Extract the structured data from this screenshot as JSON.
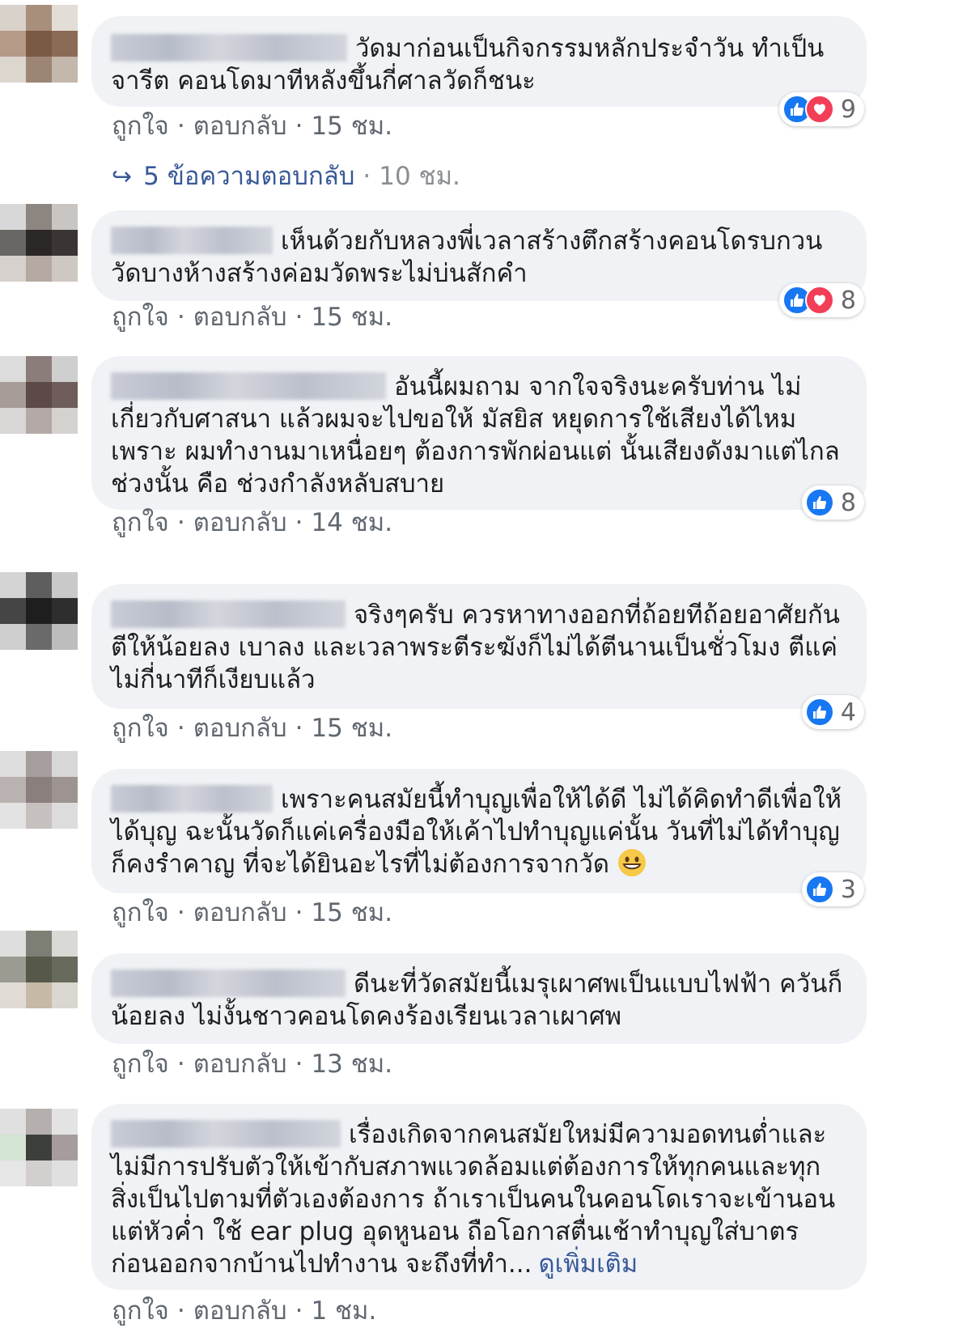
{
  "actions": {
    "like_label": "ถูกใจ",
    "reply_label": "ตอบกลับ",
    "separator": "·"
  },
  "colors": {
    "bubble": "#f0f2f5",
    "like_blue": "#1877f2",
    "love_red": "#f33e58",
    "link": "#385898",
    "meta_text": "#606770"
  },
  "comments": [
    {
      "text": "วัดมาก่อนเป็นกิจกรรมหลักประจำวัน ทำเป็นจารีต คอนโดมาทีหลังขึ้นกี่ศาลวัดก็ชนะ",
      "reactions": {
        "icons": [
          "like-icon",
          "love-icon"
        ],
        "count": "9"
      },
      "time": "15 ชม.",
      "replies": {
        "label": "5 ข้อความตอบกลับ",
        "time": "10 ชม."
      }
    },
    {
      "text": "เห็นด้วยกับหลวงพี่เวลาสร้างตึกสร้างคอนโดรบกวนวัดบางห้างสร้างค่อมวัดพระไม่บ่นสักคำ",
      "reactions": {
        "icons": [
          "like-icon",
          "love-icon"
        ],
        "count": "8"
      },
      "time": "15 ชม."
    },
    {
      "text": "อันนี้ผมถาม จากใจจริงนะครับท่าน ไม่เกี่ยวกับศาสนา แล้วผมจะไปขอให้ มัสยิส หยุดการใช้เสียงได้ไหม เพราะ ผมทำงานมาเหนื่อยๆ ต้องการพักผ่อนแต่ นั้นเสียงดังมาแต่ไกล ช่วงนั้น คือ ช่วงกำลังหลับสบาย",
      "reactions": {
        "icons": [
          "like-icon"
        ],
        "count": "8"
      },
      "time": "14 ชม."
    },
    {
      "text": "จริงๆครับ ควรหาทางออกที่ถ้อยทีถ้อยอาศัยกัน ตีให้น้อยลง เบาลง และเวลาพระตีระฆังก็ไม่ได้ตีนานเป็นชั่วโมง ตีแค่ไม่กี่นาทีก็เงียบแล้ว",
      "reactions": {
        "icons": [
          "like-icon"
        ],
        "count": "4"
      },
      "time": "15 ชม."
    },
    {
      "text": "เพราะคนสมัยนี้ทำบุญเพื่อให้ได้ดี ไม่ได้คิดทำดีเพื่อให้ได้บุญ ฉะนั้นวัดก็แค่เครื่องมือให้เค้าไปทำบุญแค่นั้น วันที่ไม่ได้ทำบุญก็คงรำคาญ ที่จะได้ยินอะไรที่ไม่ต้องการจากวัด",
      "emoji": "grinning-face-icon",
      "reactions": {
        "icons": [
          "like-icon"
        ],
        "count": "3"
      },
      "time": "15 ชม."
    },
    {
      "text": "ดีนะที่วัดสมัยนี้เมรุเผาศพเป็นแบบไฟฟ้า ควันก็น้อยลง ไม่งั้นชาวคอนโดคงร้องเรียนเวลาเผาศพ",
      "time": "13 ชม."
    },
    {
      "text": "เรื่องเกิดจากคนสมัยใหม่มีความอดทนต่ำและไม่มีการปรับตัวให้เข้ากับสภาพแวดล้อมแต่ต้องการให้ทุกคนและทุกสิ่งเป็นไปตามที่ตัวเองต้องการ ถ้าเราเป็นคนในคอนโดเราจะเข้านอนแต่หัวค่ำ ใช้ ear plug อุดหูนอน ถือโอกาสตื่นเช้าทำบุญใส่บาตรก่อนออกจากบ้านไปทำงาน จะถึงที่ทำ...",
      "see_more": "ดูเพิ่มเติม",
      "time": "1 ชม."
    }
  ]
}
